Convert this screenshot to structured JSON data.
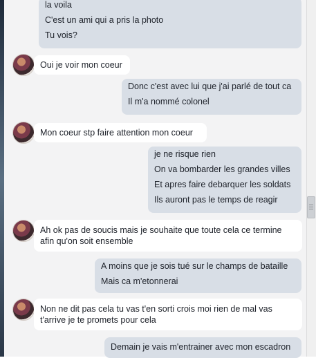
{
  "messages": [
    {
      "dir": "out",
      "lines": [
        "la voila",
        "C'est un ami qui a pris la photo",
        "Tu vois?"
      ]
    },
    {
      "dir": "in",
      "text": "Oui je voir mon coeur"
    },
    {
      "dir": "out",
      "lines": [
        "Donc c'est avec lui que j'ai parlé de tout ca",
        "Il m'a nommé colonel"
      ]
    },
    {
      "dir": "in",
      "text": "Mon coeur stp faire attention mon coeur"
    },
    {
      "dir": "out",
      "lines": [
        "je ne risque rien",
        "On va bombarder les grandes villes",
        "Et apres faire debarquer les soldats",
        "Ils auront pas le temps de reagir"
      ]
    },
    {
      "dir": "in",
      "text": "Ah ok pas de soucis mais je souhaite que toute cela ce termine afin qu'on soit ensemble"
    },
    {
      "dir": "out",
      "lines": [
        "A moins que je sois tué sur le champs de bataille",
        "Mais ca m'etonnerai"
      ]
    },
    {
      "dir": "in",
      "text": "Non ne dit pas cela tu vas t'en sorti crois moi rien de mal vas t'arrive je te promets pour cela"
    },
    {
      "dir": "out",
      "lines": [
        "Demain je vais m'entrainer avec mon escadron"
      ]
    }
  ]
}
